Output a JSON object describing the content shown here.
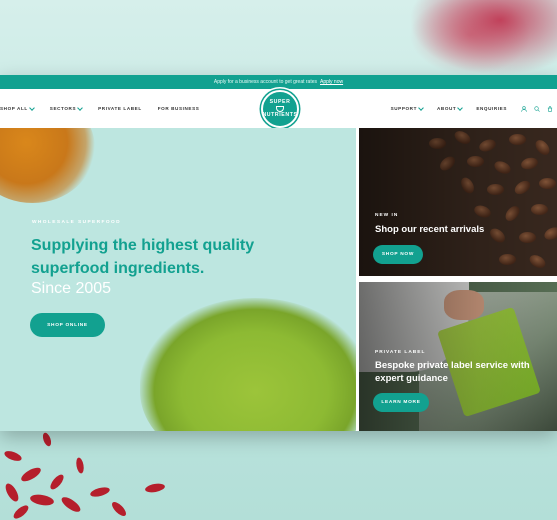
{
  "announcement": {
    "text": "Apply for a business account to get great rates",
    "link": "Apply now"
  },
  "nav": {
    "left": [
      {
        "label": "SHOP ALL",
        "dropdown": true
      },
      {
        "label": "SECTORS",
        "dropdown": true
      },
      {
        "label": "PRIVATE LABEL",
        "dropdown": false
      },
      {
        "label": "FOR BUSINESS",
        "dropdown": false
      }
    ],
    "right": [
      {
        "label": "SUPPORT",
        "dropdown": true
      },
      {
        "label": "ABOUT",
        "dropdown": true
      },
      {
        "label": "ENQUIRIES",
        "dropdown": false
      }
    ],
    "icons": [
      "user-icon",
      "search-icon",
      "cart-icon"
    ],
    "logo": {
      "line1": "SUPER",
      "line2": "NUTRIENTS"
    }
  },
  "hero": {
    "eyebrow": "WHOLESALE SUPERFOOD",
    "headline": "Supplying the highest quality superfood ingredients.",
    "subline": "Since 2005",
    "button": "SHOP ONLINE"
  },
  "cards": [
    {
      "eyebrow": "NEW IN",
      "title": "Shop our recent arrivals",
      "button": "SHOP NOW"
    },
    {
      "eyebrow": "PRIVATE LABEL",
      "title": "Bespoke private label service with expert guidance",
      "button": "LEARN MORE"
    }
  ],
  "colors": {
    "brand_teal": "#12a190",
    "hero_bg": "#bde6e0"
  }
}
